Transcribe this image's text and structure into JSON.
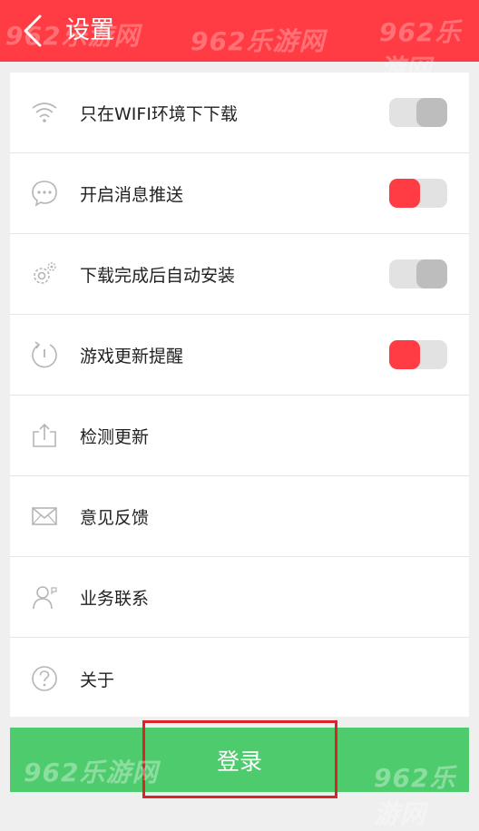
{
  "header": {
    "title": "设置"
  },
  "settings": [
    {
      "label": "只在WIFI环境下下载",
      "icon": "wifi-icon",
      "toggle": "off"
    },
    {
      "label": "开启消息推送",
      "icon": "message-bubble-icon",
      "toggle": "on"
    },
    {
      "label": "下载完成后自动安装",
      "icon": "gear-icon",
      "toggle": "off"
    },
    {
      "label": "游戏更新提醒",
      "icon": "refresh-icon",
      "toggle": "on"
    }
  ],
  "actions": [
    {
      "label": "检测更新",
      "icon": "upload-icon"
    },
    {
      "label": "意见反馈",
      "icon": "envelope-icon"
    },
    {
      "label": "业务联系",
      "icon": "contact-person-icon"
    },
    {
      "label": "关于",
      "icon": "question-icon"
    }
  ],
  "login_button": {
    "label": "登录"
  },
  "watermark": {
    "text": "962乐游网"
  },
  "colors": {
    "header": "#ff3b43",
    "toggle_on": "#ff3b43",
    "toggle_off_knob": "#bdbdbd",
    "toggle_track": "#e2e2e2",
    "login_button": "#4ecb6d",
    "highlight_border": "#d9242a",
    "background": "#efefef"
  }
}
